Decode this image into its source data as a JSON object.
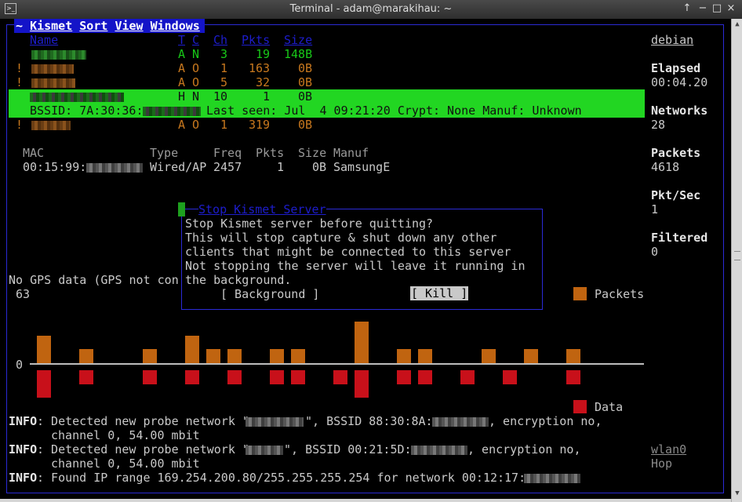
{
  "window": {
    "title": "Terminal - adam@marakihau: ~",
    "controls": [
      "↑",
      "−",
      "□",
      "×"
    ]
  },
  "menubar": {
    "prefix": "~ ",
    "items": [
      "Kismet",
      "Sort",
      "View",
      "Windows"
    ]
  },
  "network_table": {
    "headers": {
      "name": "Name",
      "t": "T",
      "c": "C",
      "ch": "Ch",
      "pkts": "Pkts",
      "size": "Size"
    },
    "rows": [
      {
        "flag": "",
        "t": "A",
        "c": "N",
        "ch": "3",
        "pkts": "19",
        "size": "148B",
        "color": "#18c818"
      },
      {
        "flag": "!",
        "t": "A",
        "c": "O",
        "ch": "1",
        "pkts": "163",
        "size": "0B",
        "color": "#c8781e"
      },
      {
        "flag": "!",
        "t": "A",
        "c": "O",
        "ch": "5",
        "pkts": "32",
        "size": "0B",
        "color": "#c8781e"
      },
      {
        "flag": "",
        "t": "H",
        "c": "N",
        "ch": "10",
        "pkts": "1",
        "size": "0B",
        "color": "#111111"
      },
      {
        "flag": "!",
        "t": "A",
        "c": "O",
        "ch": "1",
        "pkts": "319",
        "size": "0B",
        "color": "#c8781e"
      }
    ],
    "selected_detail": {
      "bssid_prefix": "BSSID: 7A:30:36:",
      "rest": "Last seen: Jul  4 09:21:20 Crypt: None Manuf: Unknown"
    }
  },
  "client_table": {
    "headers": {
      "mac": "MAC",
      "type": "Type",
      "freq": "Freq",
      "pkts": "Pkts",
      "size": "Size",
      "manuf": "Manuf"
    },
    "rows": [
      {
        "mac": "00:15:99:",
        "type": "Wired/AP",
        "freq": "2457",
        "pkts": "1",
        "size": "0B",
        "manuf": "SamsungE"
      }
    ]
  },
  "sidebar": {
    "hostname": "debian",
    "stats": [
      {
        "label": "Elapsed",
        "value": "00:04.20"
      },
      {
        "label": "Networks",
        "value": "28"
      },
      {
        "label": "Packets",
        "value": "4618"
      },
      {
        "label": "Pkt/Sec",
        "value": "1"
      },
      {
        "label": "Filtered",
        "value": "0"
      }
    ],
    "interface": "wlan0",
    "interface_state": "Hop"
  },
  "gps_text": "No GPS data (GPS not con",
  "dialog": {
    "title": "Stop Kismet Server",
    "lines": [
      "Stop Kismet server before quitting?",
      "This will stop capture & shut down any other",
      "clients that might be connected to this server",
      "Not stopping the server will leave it running in",
      "the background."
    ],
    "buttons": {
      "background": "[ Background ]",
      "kill": "[ Kill ]"
    }
  },
  "graph": {
    "max_label": "63",
    "zero_label": "0",
    "legend": {
      "packets": "Packets",
      "data": "Data"
    },
    "colors": {
      "packets": "#c06410",
      "data": "#c8101a"
    },
    "packets": [
      0.28,
      0,
      0.14,
      0,
      0,
      0.14,
      0,
      0.28,
      0.14,
      0.14,
      0,
      0.14,
      0.14,
      0,
      0,
      0.42,
      0,
      0.14,
      0.14,
      0,
      0,
      0.14,
      0,
      0.14,
      0,
      0.14,
      0
    ],
    "data": [
      0.28,
      0,
      0.14,
      0,
      0,
      0.14,
      0,
      0.14,
      0,
      0.14,
      0,
      0.14,
      0.14,
      0,
      0.14,
      0.28,
      0,
      0.14,
      0.14,
      0,
      0.14,
      0,
      0.14,
      0,
      0,
      0.14,
      0
    ]
  },
  "log": [
    {
      "tag": "INFO",
      "a": ": Detected new probe network \"",
      "b": "\", BSSID 88:30:8A:",
      "c": ", encryption no,",
      "d": "channel 0, 54.00 mbit"
    },
    {
      "tag": "INFO",
      "a": ": Detected new probe network \"",
      "b": "\", BSSID 00:21:5D:",
      "c": ", encryption no,",
      "d": "channel 0, 54.00 mbit"
    },
    {
      "tag": "INFO",
      "a": ": Found IP range 169.254.200.80/255.255.255.254 for network 00:12:17:",
      "b": "",
      "c": "",
      "d": ""
    }
  ]
}
